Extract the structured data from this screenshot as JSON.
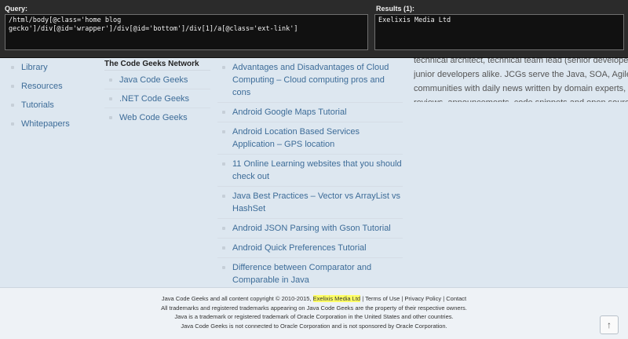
{
  "xpath_helper": {
    "query_label": "Query:",
    "query_text": "/html/body[@class='home blog gecko']/div[@id='wrapper']/div[@id='bottom']/div[1]/a[@class='ext-link']",
    "results_label": "Results (1):",
    "results_text": "Exelixis Media Ltd"
  },
  "links": [
    "Library",
    "Resources",
    "Tutorials",
    "Whitepapers"
  ],
  "network": {
    "title": "The Code Geeks Network",
    "items": [
      "Java Code Geeks",
      ".NET Code Geeks",
      "Web Code Geeks"
    ]
  },
  "posts": [
    "Advantages and Disadvantages of Cloud Computing – Cloud computing pros and cons",
    "Android Google Maps Tutorial",
    "Android Location Based Services Application – GPS location",
    "11 Online Learning websites that you should check out",
    "Java Best Practices – Vector vs ArrayList vs HashSet",
    "Android JSON Parsing with Gson Tutorial",
    "Android Quick Preferences Tutorial",
    "Difference between Comparator and Comparable in Java"
  ],
  "about": [
    "technical architect, technical team lead (senior developer),",
    "junior developers alike. JCGs serve the Java, SOA, Agile ar",
    "communities with daily news written by domain experts, artic",
    "reviews, announcements, code snippets and open source p"
  ],
  "footer": {
    "copyright_prefix": "Java Code Geeks and all content copyright © 2010-2015,",
    "company": "Exelixis Media Ltd",
    "sep1": "|",
    "terms": "Terms of Use",
    "sep2": "|",
    "privacy": "Privacy Policy",
    "sep3": "|",
    "contact": "Contact",
    "trademarks": "All trademarks and registered trademarks appearing on Java Code Geeks are the property of their respective owners.",
    "java_tm": "Java is a trademark or registered trademark of Oracle Corporation in the United States and other countries.",
    "not_connected": "Java Code Geeks is not connected to Oracle Corporation and is not sponsored by Oracle Corporation.",
    "scroll_top_icon": "↑"
  }
}
